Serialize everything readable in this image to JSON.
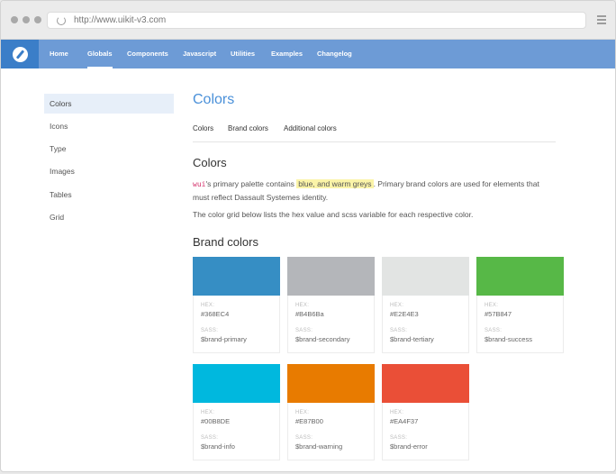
{
  "browser": {
    "url": "http://www.uikit-v3.com"
  },
  "nav": {
    "items": [
      "Home",
      "Globals",
      "Components",
      "Javascript",
      "Utilities",
      "Examples",
      "Changelog"
    ],
    "active": "Globals"
  },
  "sidebar": {
    "items": [
      "Colors",
      "Icons",
      "Type",
      "Images",
      "Tables",
      "Grid"
    ],
    "active": "Colors"
  },
  "main": {
    "title": "Colors",
    "tabs": [
      "Colors",
      "Brand colors",
      "Additional colors"
    ],
    "section_heading": "Colors",
    "intro_code": "wui",
    "intro_before": "'s primary palette contains ",
    "intro_highlight": "blue, and warm greys",
    "intro_after": ". Primary brand colors are used for elements that must reflect Dassault Systemes identity.",
    "grid_text": "The color grid below lists the hex value and scss variable for each respective color.",
    "brand_heading": "Brand colors",
    "hex_label": "HEX:",
    "sass_label": "SASS:",
    "colors": [
      {
        "hex": "#368EC4",
        "sass": "$brand-primary"
      },
      {
        "hex": "#B4B6Ba",
        "sass": "$brand-secondary"
      },
      {
        "hex": "#E2E4E3",
        "sass": "$brand-tertiary"
      },
      {
        "hex": "#57B847",
        "sass": "$brand-success"
      },
      {
        "hex": "#00B8DE",
        "sass": "$brand-info"
      },
      {
        "hex": "#E87B00",
        "sass": "$brand-warning"
      },
      {
        "hex": "#EA4F37",
        "sass": "$brand-error"
      }
    ]
  },
  "theme": {
    "nav_bg": "#6d9bd6",
    "logo_bg": "#3b7ec8",
    "title_color": "#4a90d9"
  }
}
